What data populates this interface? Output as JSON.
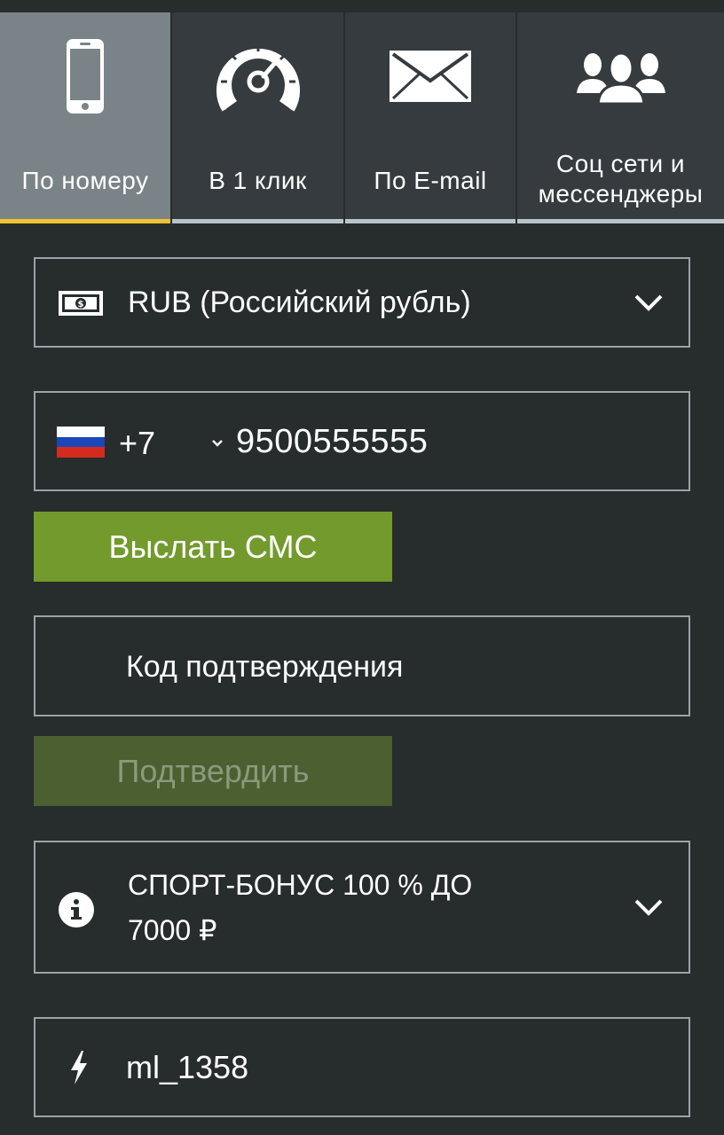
{
  "tabs": [
    {
      "label": "По номеру",
      "icon": "phone-icon",
      "active": true
    },
    {
      "label": "В 1 клик",
      "icon": "speedometer-icon",
      "active": false
    },
    {
      "label": "По E-mail",
      "icon": "envelope-icon",
      "active": false
    },
    {
      "label": "Соц сети и мессенджеры",
      "icon": "people-icon",
      "active": false
    }
  ],
  "currency": {
    "icon": "money-icon",
    "value": "RUB (Российский рубль)"
  },
  "phone": {
    "flag": "russia-flag-icon",
    "country_code": "+7",
    "number": "9500555555"
  },
  "send_sms_label": "Выслать СМС",
  "confirmation_code": {
    "placeholder": "Код подтверждения"
  },
  "confirm_label": "Подтвердить",
  "bonus": {
    "icon": "info-icon",
    "line1": "СПОРТ-БОНУС 100 % ДО",
    "line2": "7000 ₽"
  },
  "promo": {
    "icon": "lightning-icon",
    "value": "ml_1358"
  },
  "colors": {
    "background": "#272c2c",
    "active_tab": "#7a8488",
    "active_underline": "#f1c232",
    "send_button": "#739a2d",
    "confirm_button_disabled": "#4b5f31"
  }
}
